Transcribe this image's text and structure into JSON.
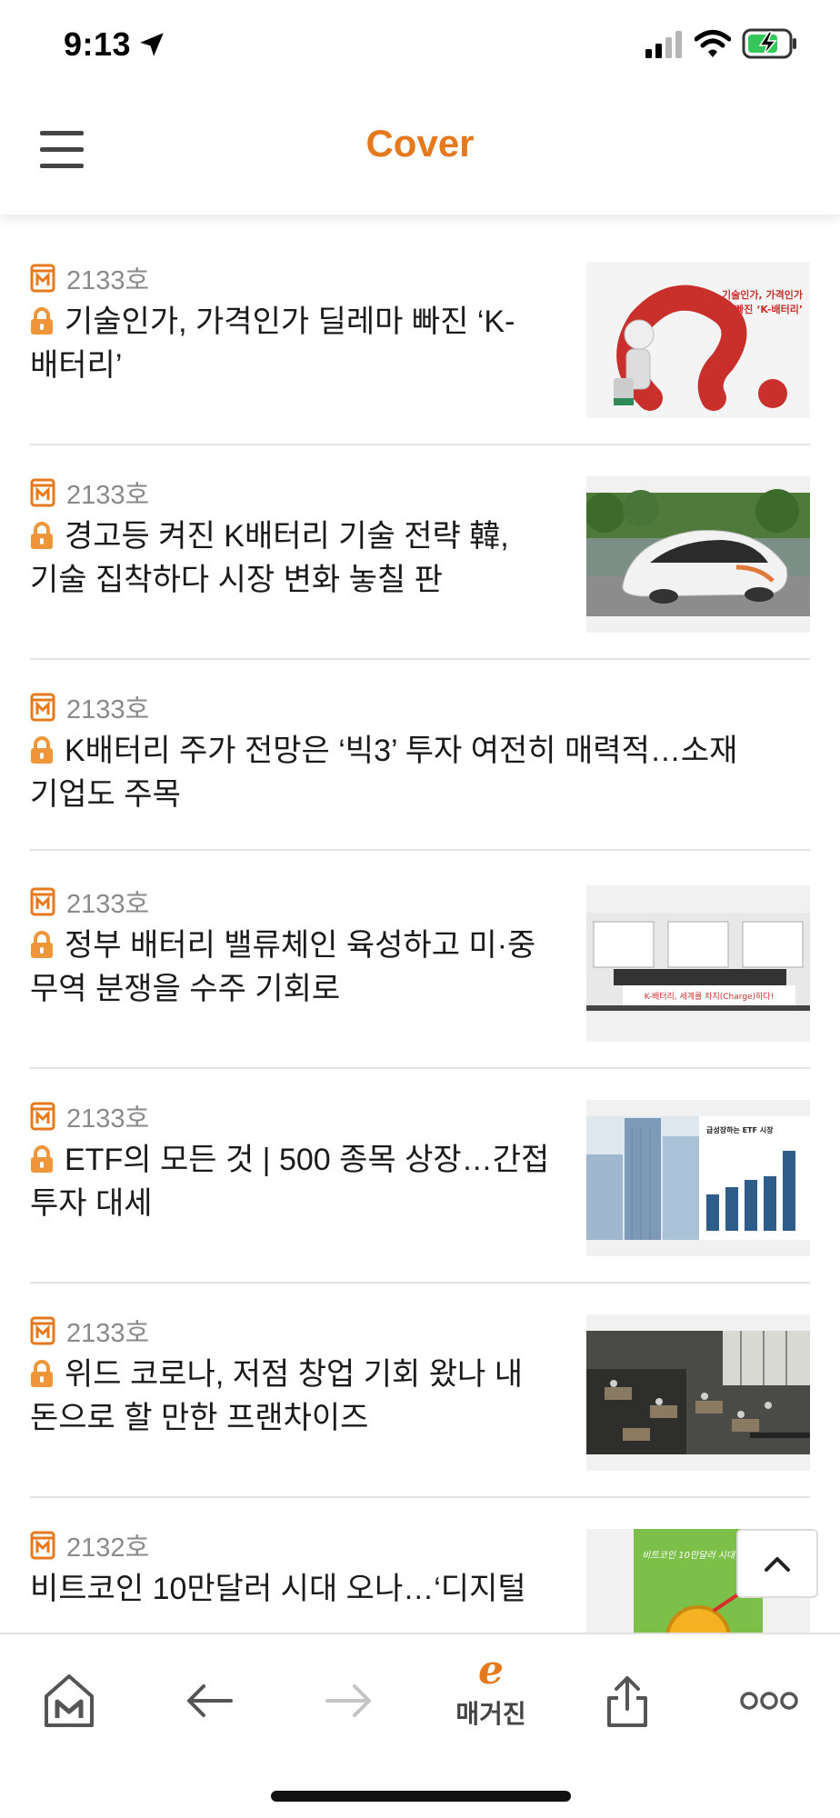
{
  "status_bar": {
    "time": "9:13"
  },
  "header": {
    "title": "Cover"
  },
  "articles": [
    {
      "issue": "2133호",
      "title": "기술인가, 가격인가 딜레마 빠진 ‘K-배터리’",
      "locked": true,
      "thumbnail": "k-battery-dilemma",
      "thumb_text": "기술인가, 가격인가 딜레마 빠진 ‘K-배터리’"
    },
    {
      "issue": "2133호",
      "title": "경고등 켜진 K배터리 기술 전략 韓, 기술 집착하다 시장 변화 놓칠 판",
      "locked": true,
      "thumbnail": "concept-car"
    },
    {
      "issue": "2133호",
      "title": "K배터리 주가 전망은 ‘빅3’ 투자 여전히 매력적…소재 기업도 주목",
      "locked": true,
      "thumbnail": ""
    },
    {
      "issue": "2133호",
      "title": "정부 배터리 밸류체인 육성하고 미·중 무역 분쟁을 수주 기회로",
      "locked": true,
      "thumbnail": "government-event",
      "thumb_text": "K-배터리, 세계를 차지(Charge)하다!"
    },
    {
      "issue": "2133호",
      "title": "ETF의 모든 것 | 500 종목 상장…간접 투자 대세",
      "locked": true,
      "thumbnail": "etf-chart",
      "thumb_text": "급성장하는 ETF 시장"
    },
    {
      "issue": "2133호",
      "title": "위드 코로나, 저점 창업 기회 왔나 내 돈으로 할 만한 프랜차이즈",
      "locked": true,
      "thumbnail": "cafe-interior"
    },
    {
      "issue": "2132호",
      "title": "비트코인 10만달러 시대 오나…‘디지털",
      "locked": false,
      "thumbnail": "bitcoin",
      "thumb_text": "비트코인 10만달러 시대 오나"
    }
  ],
  "bottom_bar": {
    "items": [
      {
        "name": "home",
        "icon": "magazine-home-icon"
      },
      {
        "name": "back",
        "icon": "arrow-left-icon"
      },
      {
        "name": "forward",
        "icon": "arrow-right-icon"
      },
      {
        "name": "e-magazine",
        "icon": "e-icon",
        "e_glyph": "e",
        "label": "매거진"
      },
      {
        "name": "share",
        "icon": "share-icon"
      },
      {
        "name": "more",
        "icon": "more-icon"
      }
    ]
  },
  "colors": {
    "accent": "#e4791d",
    "lock": "#f0963a",
    "divider": "#e3e3e3"
  }
}
